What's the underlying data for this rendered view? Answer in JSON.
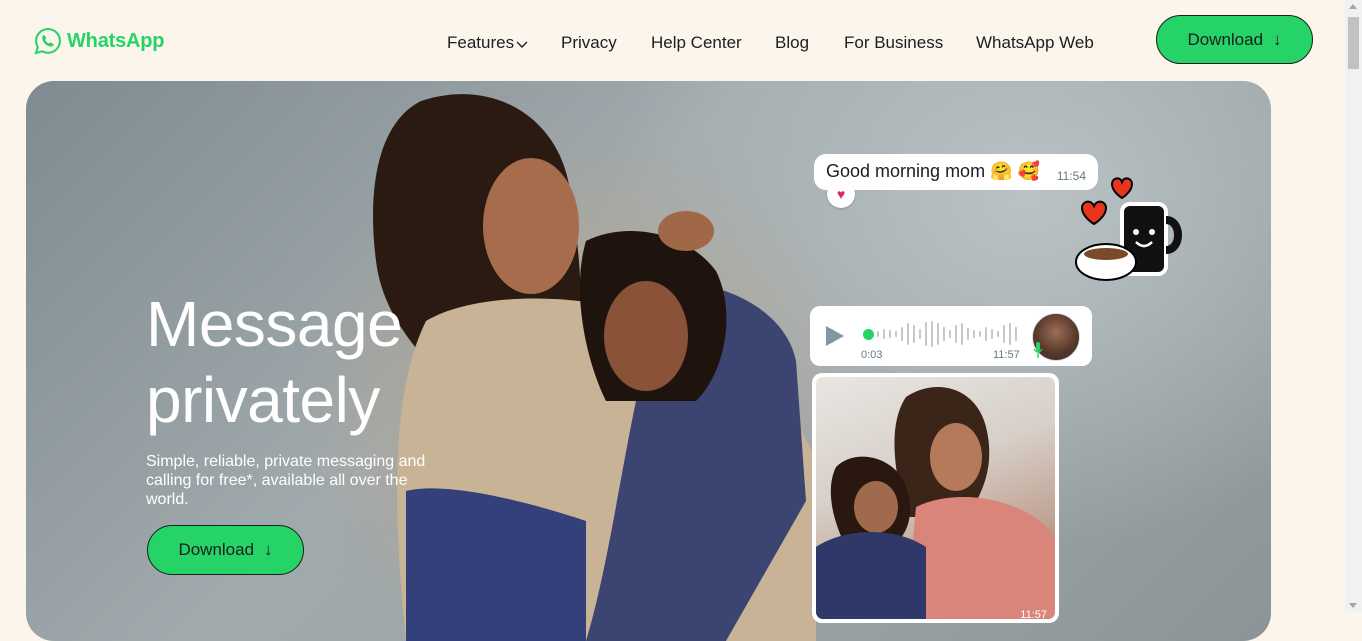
{
  "brand": {
    "name": "WhatsApp",
    "color": "#25d366"
  },
  "nav": {
    "features": "Features",
    "privacy": "Privacy",
    "help_center": "Help Center",
    "blog": "Blog",
    "for_business": "For Business",
    "whatsapp_web": "WhatsApp Web"
  },
  "header": {
    "download_label": "Download",
    "download_arrow": "↓"
  },
  "hero": {
    "title_line1": "Message",
    "title_line2": "privately",
    "subtitle": "Simple, reliable, private messaging and calling for free*, available all over the world.",
    "download_label": "Download",
    "download_arrow": "↓"
  },
  "chat": {
    "text_message": "Good morning mom 🤗 🥰",
    "text_time": "11:54",
    "reaction": "♥",
    "voice_elapsed": "0:03",
    "voice_time": "11:57",
    "photo_time": "11:57"
  }
}
